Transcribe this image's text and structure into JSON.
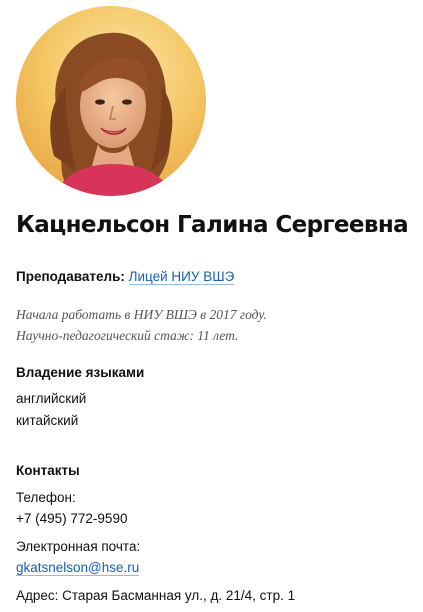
{
  "profile": {
    "name": "Кацнельсон Галина Сергеевна",
    "photo": "profile-photo",
    "role_label": "Преподаватель:",
    "role_link": "Лицей НИУ ВШЭ",
    "started": "Начала работать в НИУ ВШЭ в 2017 году.",
    "experience": "Научно-педагогический стаж: 11 лет."
  },
  "languages": {
    "title": "Владение языками",
    "items": [
      "английский",
      "китайский"
    ]
  },
  "contacts": {
    "title": "Контакты",
    "phone_label": "Телефон:",
    "phone": "+7 (495) 772-9590",
    "email_label": "Электронная почта:",
    "email": "gkatsnelson@hse.ru",
    "address": "Адрес: Старая Басманная ул., д. 21/4, стр. 1"
  },
  "colors": {
    "link": "#1a5fb4",
    "muted_text": "#555555",
    "text": "#111111"
  }
}
